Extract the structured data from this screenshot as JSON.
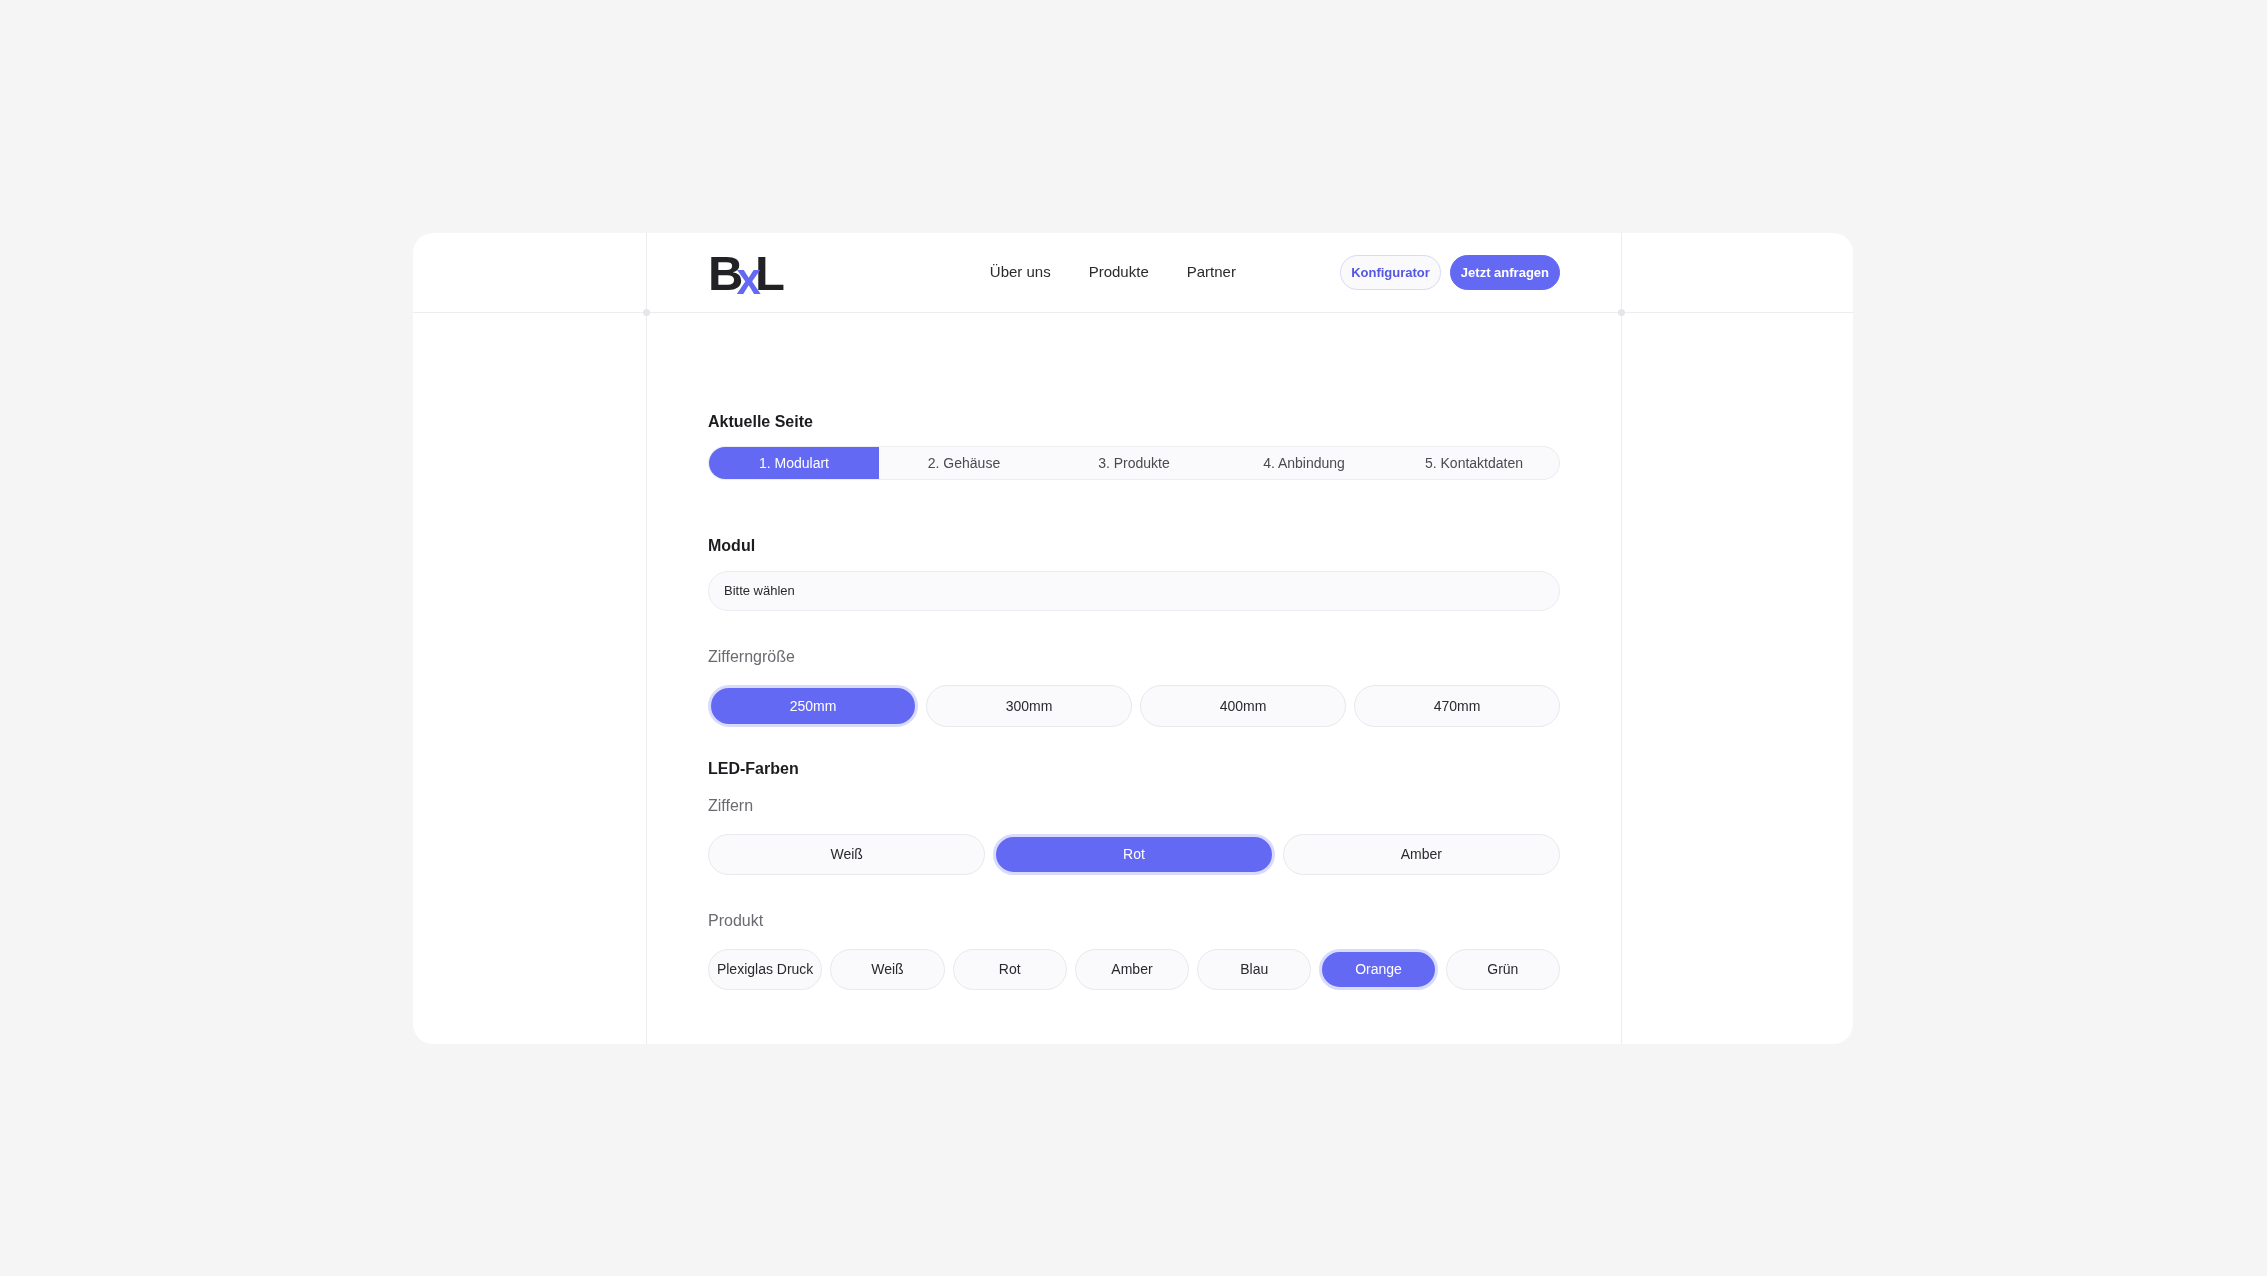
{
  "header": {
    "logo": {
      "letters": [
        "B",
        "x",
        "L"
      ]
    },
    "nav": [
      {
        "label": "Über uns"
      },
      {
        "label": "Produkte"
      },
      {
        "label": "Partner"
      }
    ],
    "buttons": [
      {
        "label": "Konfigurator",
        "kind": "outline"
      },
      {
        "label": "Jetzt anfragen",
        "kind": "primary"
      }
    ]
  },
  "steps": {
    "title": "Aktuelle Seite",
    "items": [
      {
        "label": "1. Modulart",
        "selected": true
      },
      {
        "label": "2. Gehäuse",
        "selected": false
      },
      {
        "label": "3. Produkte",
        "selected": false
      },
      {
        "label": "4. Anbindung",
        "selected": false
      },
      {
        "label": "5. Kontaktdaten",
        "selected": false
      }
    ]
  },
  "modul": {
    "title": "Modul",
    "select": {
      "value": "Bitte wählen"
    }
  },
  "zifferngroesse": {
    "label": "Zifferngröße",
    "options": [
      {
        "label": "250mm",
        "selected": true
      },
      {
        "label": "300mm",
        "selected": false
      },
      {
        "label": "400mm",
        "selected": false
      },
      {
        "label": "470mm",
        "selected": false
      }
    ]
  },
  "led_farben": {
    "title": "LED-Farben",
    "groups": [
      {
        "label": "Ziffern",
        "options": [
          {
            "label": "Weiß",
            "selected": false
          },
          {
            "label": "Rot",
            "selected": true
          },
          {
            "label": "Amber",
            "selected": false
          }
        ]
      },
      {
        "label": "Produkt",
        "options": [
          {
            "label": "Plexiglas Druck",
            "selected": false
          },
          {
            "label": "Weiß",
            "selected": false
          },
          {
            "label": "Rot",
            "selected": false
          },
          {
            "label": "Amber",
            "selected": false
          },
          {
            "label": "Blau",
            "selected": false
          },
          {
            "label": "Orange",
            "selected": true
          },
          {
            "label": "Grün",
            "selected": false
          }
        ]
      }
    ]
  }
}
